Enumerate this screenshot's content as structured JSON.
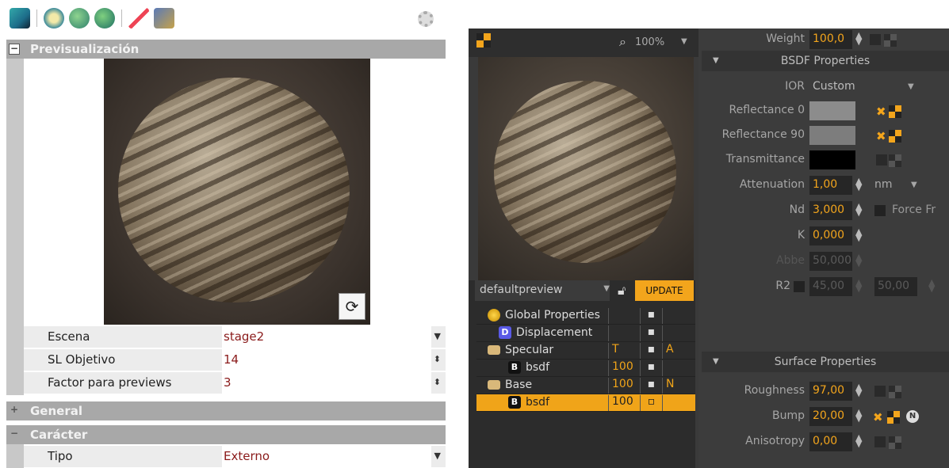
{
  "left": {
    "toolbar": {
      "icons": [
        "add-material-icon",
        "info-icon",
        "globe-icon",
        "globe-edit-icon",
        "picker-icon",
        "map-icon",
        "settings-icon"
      ]
    },
    "preview_section": {
      "expander": "−",
      "title": "Previsualización"
    },
    "properties": [
      {
        "label": "Escena",
        "value": "stage2",
        "arrow": "▼"
      },
      {
        "label": "SL Objetivo",
        "value": "14",
        "arrow": "⬍"
      },
      {
        "label": "Factor para previews",
        "value": "3",
        "arrow": "⬍"
      }
    ],
    "general_section": {
      "expander": "+",
      "title": "General"
    },
    "caracter_section": {
      "expander": "−",
      "title": "Carácter"
    },
    "tipo": {
      "label": "Tipo",
      "value": "Externo",
      "arrow": "▼"
    }
  },
  "right": {
    "zoom": "100%",
    "scene_select": "defaultpreview",
    "update_label": "UPDATE",
    "tree": [
      {
        "label": "Global Properties",
        "c1": "",
        "c2": "▪",
        "c3": "",
        "badge": "",
        "badge_color": "#f3c31c",
        "indent": 14
      },
      {
        "label": "Displacement",
        "c1": "",
        "c2": "▪",
        "c3": "",
        "badge": "D",
        "badge_color": "#5a5ae6",
        "indent": 28
      },
      {
        "label": "Specular",
        "c1": "T",
        "c2": "▪",
        "c3": "A",
        "badge": "",
        "badge_color": "",
        "indent": 14
      },
      {
        "label": "bsdf",
        "c1": "100",
        "c2": "▪",
        "c3": "",
        "badge": "B",
        "badge_color": "#111",
        "indent": 40
      },
      {
        "label": "Base",
        "c1": "100",
        "c2": "▪",
        "c3": "N",
        "badge": "",
        "badge_color": "",
        "indent": 14
      },
      {
        "label": "bsdf",
        "c1": "100",
        "c2": "▫",
        "c3": "",
        "badge": "B",
        "badge_color": "#111",
        "indent": 40
      }
    ],
    "props": {
      "weight": {
        "label": "Weight",
        "value": "100,0"
      },
      "bsdf_header": "BSDF Properties",
      "ior": {
        "label": "IOR",
        "value": "Custom"
      },
      "reflectance0": {
        "label": "Reflectance 0"
      },
      "reflectance90": {
        "label": "Reflectance 90"
      },
      "transmittance": {
        "label": "Transmittance"
      },
      "attenuation": {
        "label": "Attenuation",
        "value": "1,00",
        "unit": "nm"
      },
      "nd": {
        "label": "Nd",
        "value": "3,000",
        "extra": "Force Fr"
      },
      "k": {
        "label": "K",
        "value": "0,000"
      },
      "abbe": {
        "label": "Abbe",
        "value": "50,000"
      },
      "r2": {
        "label": "R2",
        "value1": "45,00",
        "value2": "50,00"
      },
      "surface_header": "Surface Properties",
      "roughness": {
        "label": "Roughness",
        "value": "97,00"
      },
      "bump": {
        "label": "Bump",
        "value": "20,00"
      },
      "anisotropy": {
        "label": "Anisotropy",
        "value": "0,00"
      }
    },
    "colors": {
      "accent": "#f3a51c",
      "reflectance0": "#8c8c8c",
      "reflectance90": "#7d7d7d",
      "transmittance": "#000000"
    }
  }
}
